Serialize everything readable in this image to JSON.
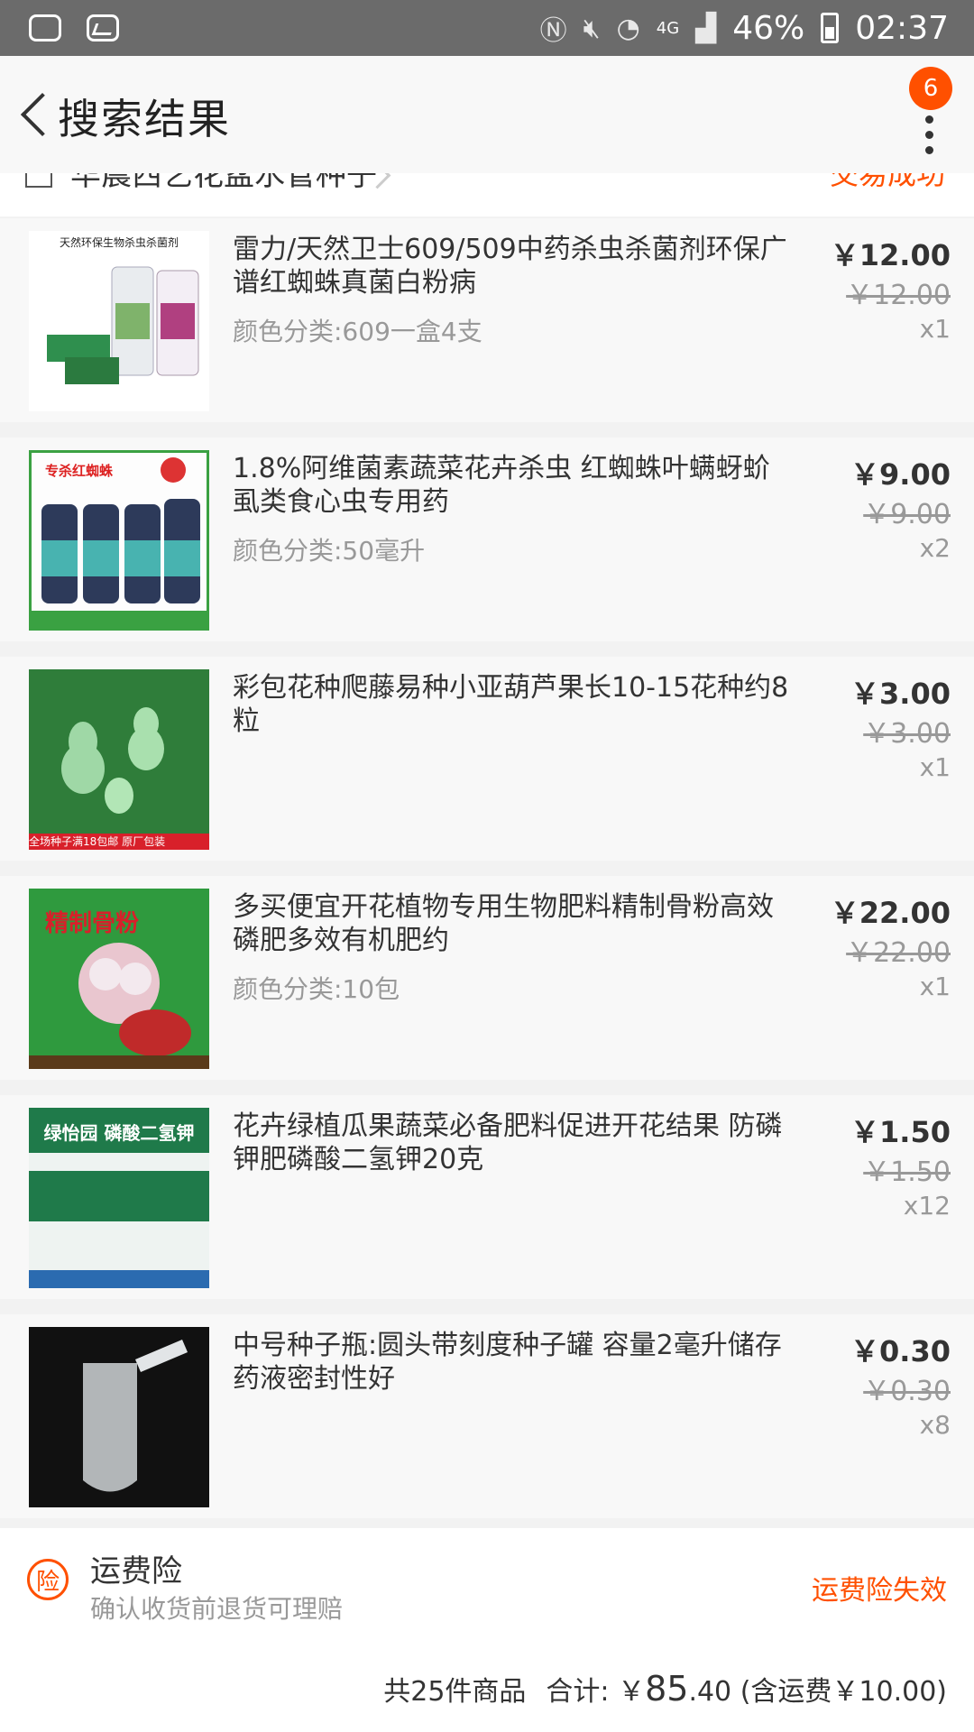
{
  "status_bar": {
    "icons": [
      "message-icon",
      "image-icon",
      "nfc-icon",
      "mute-icon",
      "wifi-icon",
      "signal-icon",
      "battery-icon"
    ],
    "network": "4G",
    "battery": "46%",
    "time": "02:37"
  },
  "header": {
    "title": "搜索结果",
    "badge_count": "6"
  },
  "shop": {
    "name": "华晨西艺花盆水管种子",
    "status": "交易成功"
  },
  "items": [
    {
      "title": "雷力/天然卫士609/509中药杀虫杀菌剂环保广谱红蜘蛛真菌白粉病",
      "sku": "颜色分类:609一盒4支",
      "price": "￥12.00",
      "orig_price": "￥12.00",
      "qty": "x1",
      "thumb_text": "天然环保生物杀虫杀菌剂"
    },
    {
      "title": "1.8%阿维菌素蔬菜花卉杀虫 红蜘蛛叶螨蚜蚧虱类食心虫专用药",
      "sku": "颜色分类:50毫升",
      "price": "￥9.00",
      "orig_price": "￥9.00",
      "qty": "x2",
      "thumb_text": "专杀红蜘蛛"
    },
    {
      "title": "彩包花种爬藤易种小亚葫芦果长10-15花种约8粒",
      "sku": "",
      "price": "￥3.00",
      "orig_price": "￥3.00",
      "qty": "x1",
      "thumb_text": "全场种子满18包邮 原厂包装"
    },
    {
      "title": "多买便宜开花植物专用生物肥料精制骨粉高效磷肥多效有机肥约",
      "sku": "颜色分类:10包",
      "price": "￥22.00",
      "orig_price": "￥22.00",
      "qty": "x1",
      "thumb_text": "精制骨粉"
    },
    {
      "title": "花卉绿植瓜果蔬菜必备肥料促进开花结果 防磷钾肥磷酸二氢钾20克",
      "sku": "",
      "price": "￥1.50",
      "orig_price": "￥1.50",
      "qty": "x12",
      "thumb_text": "绿怡园 磷酸二氢钾"
    },
    {
      "title": "中号种子瓶:圆头带刻度种子罐 容量2毫升储存药液密封性好",
      "sku": "",
      "price": "￥0.30",
      "orig_price": "￥0.30",
      "qty": "x8",
      "thumb_text": ""
    }
  ],
  "insurance": {
    "icon_text": "险",
    "title": "运费险",
    "desc": "确认收货前退货可理赔",
    "status": "运费险失效"
  },
  "summary": {
    "count": "共25件商品",
    "total_label": "合计: ￥",
    "total_int": "85",
    "total_dec": ".40",
    "shipping": "(含运费￥10.00)"
  }
}
